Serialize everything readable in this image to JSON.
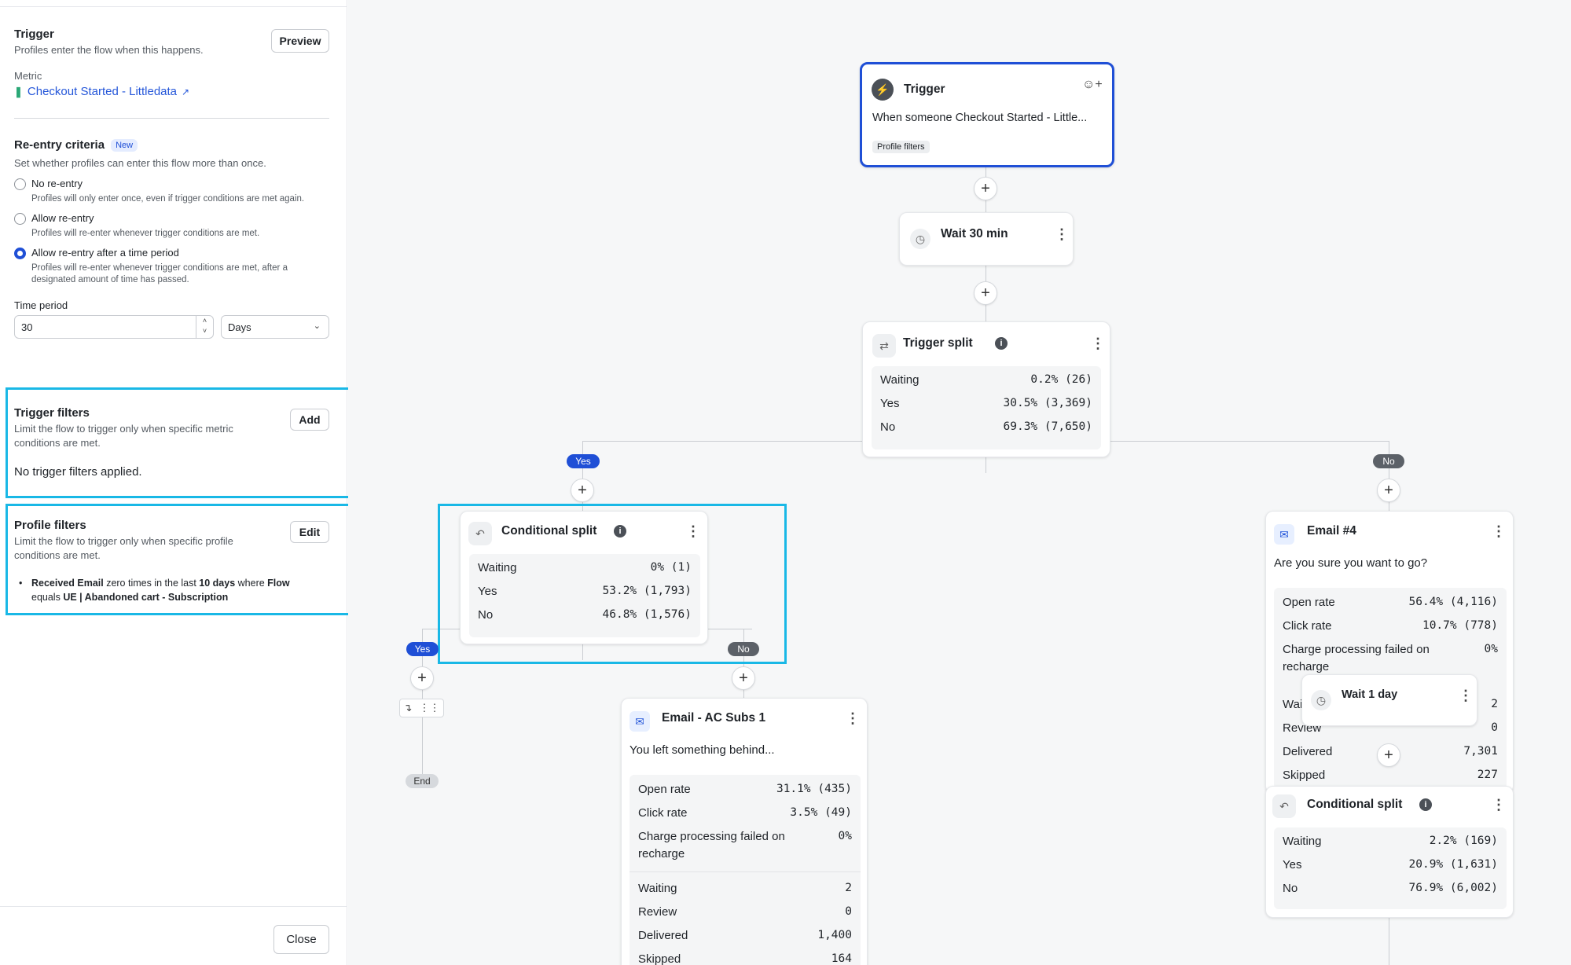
{
  "panel": {
    "trigger_title": "Trigger",
    "trigger_desc": "Profiles enter the flow when this happens.",
    "preview_btn": "Preview",
    "metric_label": "Metric",
    "metric_link": "Checkout Started - Littledata",
    "reentry_title": "Re-entry criteria",
    "new_badge": "New",
    "reentry_desc": "Set whether profiles can enter this flow more than once.",
    "options": [
      {
        "label": "No re-entry",
        "desc": "Profiles will only enter once, even if trigger conditions are met again."
      },
      {
        "label": "Allow re-entry",
        "desc": "Profiles will re-enter whenever trigger conditions are met."
      },
      {
        "label": "Allow re-entry after a time period",
        "desc": "Profiles will re-enter whenever trigger conditions are met, after a",
        "desc2": "designated amount of time has passed."
      }
    ],
    "time_period_label": "Time period",
    "time_value": "30",
    "time_unit": "Days",
    "trigger_filters_title": "Trigger filters",
    "trigger_filters_desc1": "Limit the flow to trigger only when specific metric",
    "trigger_filters_desc2": "conditions are met.",
    "add_btn": "Add",
    "no_filters": "No trigger filters applied.",
    "profile_filters_title": "Profile filters",
    "profile_filters_desc1": "Limit the flow to trigger only when specific profile",
    "profile_filters_desc2": "conditions are met.",
    "edit_btn": "Edit",
    "filter_rule": {
      "p1": "Received Email",
      "p2": " zero times in the last ",
      "p3": "10 days",
      "p4": " where ",
      "p5": "Flow",
      "p6": "equals ",
      "p7": "UE | Abandoned cart - Subscription"
    },
    "close_btn": "Close"
  },
  "flow": {
    "trigger": {
      "title": "Trigger",
      "desc": "When someone Checkout Started - Little...",
      "tag": "Profile filters"
    },
    "wait1": {
      "title": "Wait 30 min"
    },
    "trigger_split": {
      "title": "Trigger split",
      "rows": [
        [
          "Waiting",
          "0.2% (26)"
        ],
        [
          "Yes",
          "30.5% (3,369)"
        ],
        [
          "No",
          "69.3% (7,650)"
        ]
      ]
    },
    "yes_label": "Yes",
    "no_label": "No",
    "cond_split": {
      "title": "Conditional split",
      "rows": [
        [
          "Waiting",
          "0% (1)"
        ],
        [
          "Yes",
          "53.2% (1,793)"
        ],
        [
          "No",
          "46.8% (1,576)"
        ]
      ]
    },
    "end_label": "End",
    "email_ac": {
      "title": "Email - AC Subs 1",
      "subject": "You left something behind...",
      "rows": [
        [
          "Open rate",
          "31.1% (435)"
        ],
        [
          "Click rate",
          "3.5% (49)"
        ]
      ],
      "charge_label1": "Charge processing failed on",
      "charge_label2": "recharge",
      "charge_value": "0%",
      "rows2": [
        [
          "Waiting",
          "2"
        ],
        [
          "Review",
          "0"
        ],
        [
          "Delivered",
          "1,400"
        ],
        [
          "Skipped",
          "164"
        ]
      ]
    },
    "email4": {
      "title": "Email #4",
      "subject": "Are you sure you want to go?",
      "rows": [
        [
          "Open rate",
          "56.4% (4,116)"
        ],
        [
          "Click rate",
          "10.7% (778)"
        ]
      ],
      "charge_label1": "Charge processing failed on",
      "charge_label2": "recharge",
      "charge_value": "0%",
      "rows2": [
        [
          "Wai",
          "2"
        ],
        [
          "Review",
          "0"
        ],
        [
          "Delivered",
          "7,301"
        ],
        [
          "Skipped",
          "227"
        ]
      ]
    },
    "wait2": {
      "title": "Wait 1 day"
    },
    "cond_split2": {
      "title": "Conditional split",
      "rows": [
        [
          "Waiting",
          "2.2% (169)"
        ],
        [
          "Yes",
          "20.9% (1,631)"
        ],
        [
          "No",
          "76.9% (6,002)"
        ]
      ]
    }
  },
  "colors": {
    "accent": "#1f4fd6",
    "highlight": "#19b8e6",
    "link": "#2456d9"
  }
}
